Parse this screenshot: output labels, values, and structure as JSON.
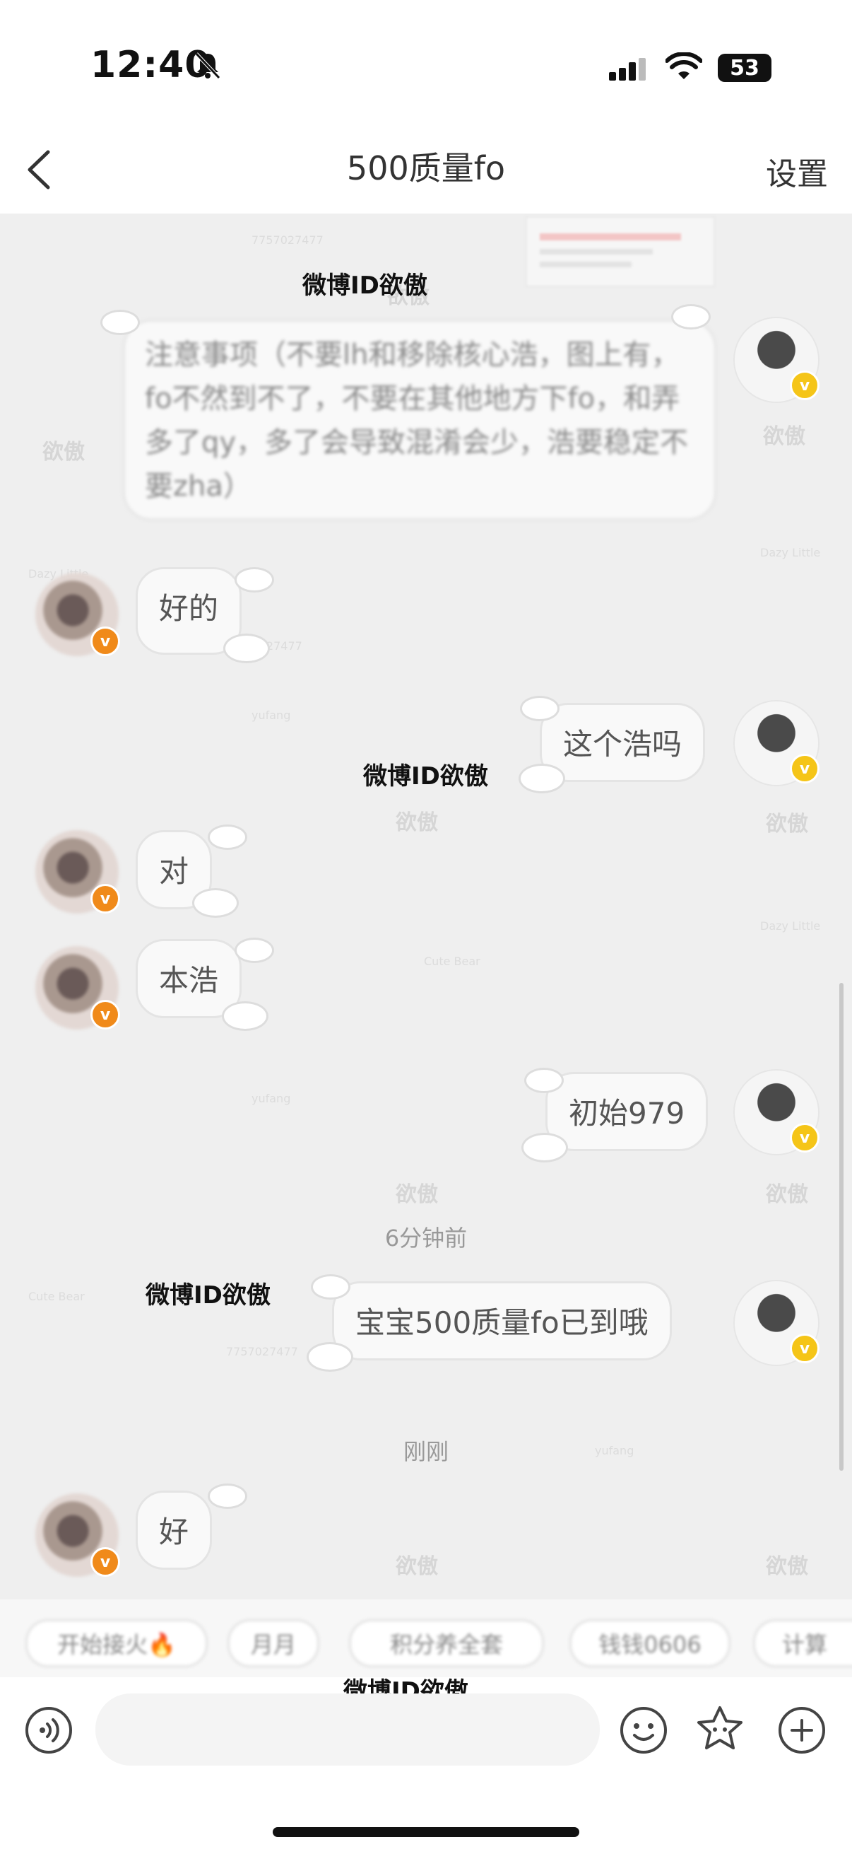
{
  "status": {
    "time": "12:40",
    "battery": "53"
  },
  "nav": {
    "title": "500质量fo",
    "settings": "设置"
  },
  "watermark": {
    "main": "微博ID欲傲",
    "brand": "欲傲",
    "sub1": "Dazy Little",
    "sub2": "Cute Bear",
    "id": "7757027477",
    "sign": "yufang"
  },
  "messages": [
    {
      "side": "right",
      "text": "注意事项（不要lh和移除核心浩，图上有，fo不然到不了，不要在其他地方下fo，和弄多了qy，多了会导致混淆会少，浩要稳定不要zha）"
    },
    {
      "side": "left",
      "text": "好的"
    },
    {
      "side": "right",
      "text": "这个浩吗"
    },
    {
      "side": "left",
      "text": "对"
    },
    {
      "side": "left",
      "text": "本浩"
    },
    {
      "side": "right",
      "text": "初始979"
    },
    {
      "side": "right",
      "text": "宝宝500质量fo已到哦"
    },
    {
      "side": "left",
      "text": "好"
    }
  ],
  "separators": {
    "six_min": "6分钟前",
    "just_now": "刚刚"
  },
  "quick_replies": [
    "开始接火🔥",
    "月月",
    "积分养全套",
    "钱钱0606",
    "计算"
  ],
  "colors": {
    "badge_yellow": "#f5c518",
    "badge_orange": "#f08a1a",
    "chat_bg": "#efefef"
  },
  "icons": [
    "voice-icon",
    "emoji-icon",
    "sticker-icon",
    "plus-icon"
  ]
}
